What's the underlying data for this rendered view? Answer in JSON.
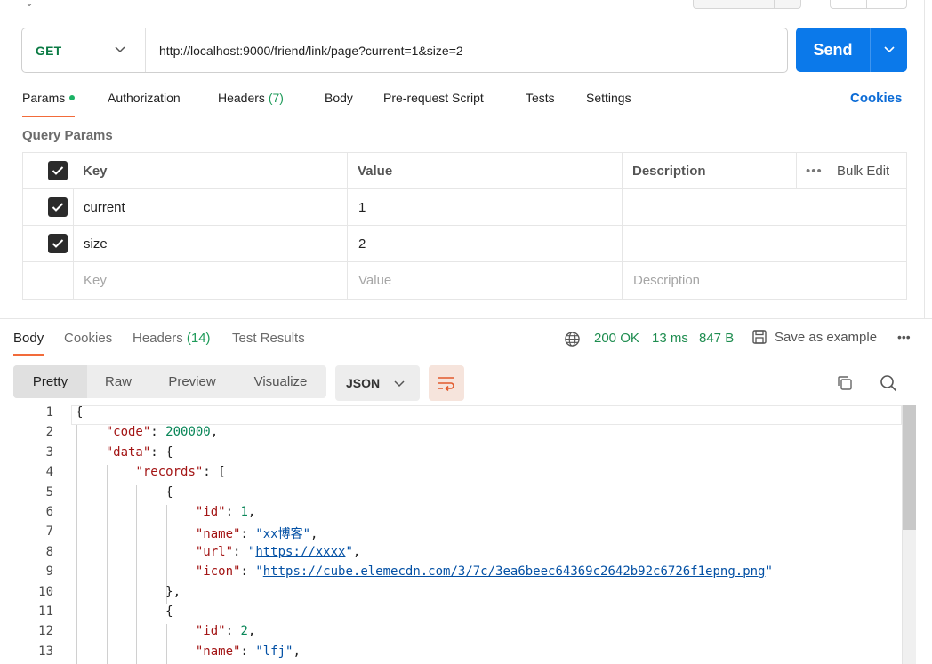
{
  "request": {
    "method": "GET",
    "url": "http://localhost:9000/friend/link/page?current=1&size=2",
    "send_label": "Send"
  },
  "request_tabs": {
    "params": "Params",
    "authorization": "Authorization",
    "headers": "Headers",
    "headers_count": "(7)",
    "body": "Body",
    "pre_request": "Pre-request Script",
    "tests": "Tests",
    "settings": "Settings",
    "cookies": "Cookies"
  },
  "query_params": {
    "title": "Query Params",
    "headers": {
      "key": "Key",
      "value": "Value",
      "description": "Description",
      "bulk_edit": "Bulk Edit"
    },
    "rows": [
      {
        "checked": true,
        "key": "current",
        "value": "1",
        "description": ""
      },
      {
        "checked": true,
        "key": "size",
        "value": "2",
        "description": ""
      }
    ],
    "placeholders": {
      "key": "Key",
      "value": "Value",
      "description": "Description"
    }
  },
  "response_tabs": {
    "body": "Body",
    "cookies": "Cookies",
    "headers": "Headers",
    "headers_count": "(14)",
    "test_results": "Test Results"
  },
  "response_meta": {
    "status": "200 OK",
    "time": "13 ms",
    "size": "847 B",
    "save_example": "Save as example"
  },
  "view_modes": [
    "Pretty",
    "Raw",
    "Preview",
    "Visualize"
  ],
  "format": "JSON",
  "colors": {
    "accent": "#f26b3a",
    "send": "#0b79ea",
    "get": "#0a7a43",
    "status_ok": "#1f8d50"
  },
  "code_lines": [
    {
      "n": "1",
      "indent": 0,
      "parts": [
        [
          "p",
          "{"
        ]
      ]
    },
    {
      "n": "2",
      "indent": 1,
      "parts": [
        [
          "k",
          "\"code\""
        ],
        [
          "p",
          ": "
        ],
        [
          "n",
          "200000"
        ],
        [
          "p",
          ","
        ]
      ]
    },
    {
      "n": "3",
      "indent": 1,
      "parts": [
        [
          "k",
          "\"data\""
        ],
        [
          "p",
          ": {"
        ]
      ]
    },
    {
      "n": "4",
      "indent": 2,
      "parts": [
        [
          "k",
          "\"records\""
        ],
        [
          "p",
          ": ["
        ]
      ]
    },
    {
      "n": "5",
      "indent": 3,
      "parts": [
        [
          "p",
          "{"
        ]
      ]
    },
    {
      "n": "6",
      "indent": 4,
      "parts": [
        [
          "k",
          "\"id\""
        ],
        [
          "p",
          ": "
        ],
        [
          "n",
          "1"
        ],
        [
          "p",
          ","
        ]
      ]
    },
    {
      "n": "7",
      "indent": 4,
      "parts": [
        [
          "k",
          "\"name\""
        ],
        [
          "p",
          ": "
        ],
        [
          "s",
          "\"xx博客\""
        ],
        [
          "p",
          ","
        ]
      ]
    },
    {
      "n": "8",
      "indent": 4,
      "parts": [
        [
          "k",
          "\"url\""
        ],
        [
          "p",
          ": "
        ],
        [
          "s",
          "\""
        ],
        [
          "u",
          "https://xxxx"
        ],
        [
          "s",
          "\""
        ],
        [
          "p",
          ","
        ]
      ]
    },
    {
      "n": "9",
      "indent": 4,
      "parts": [
        [
          "k",
          "\"icon\""
        ],
        [
          "p",
          ": "
        ],
        [
          "s",
          "\""
        ],
        [
          "u",
          "https://cube.elemecdn.com/3/7c/3ea6beec64369c2642b92c6726f1epng.png"
        ],
        [
          "s",
          "\""
        ]
      ]
    },
    {
      "n": "10",
      "indent": 3,
      "parts": [
        [
          "p",
          "},"
        ]
      ]
    },
    {
      "n": "11",
      "indent": 3,
      "parts": [
        [
          "p",
          "{"
        ]
      ]
    },
    {
      "n": "12",
      "indent": 4,
      "parts": [
        [
          "k",
          "\"id\""
        ],
        [
          "p",
          ": "
        ],
        [
          "n",
          "2"
        ],
        [
          "p",
          ","
        ]
      ]
    },
    {
      "n": "13",
      "indent": 4,
      "parts": [
        [
          "k",
          "\"name\""
        ],
        [
          "p",
          ": "
        ],
        [
          "s",
          "\"lfj\""
        ],
        [
          "p",
          ","
        ]
      ]
    }
  ]
}
